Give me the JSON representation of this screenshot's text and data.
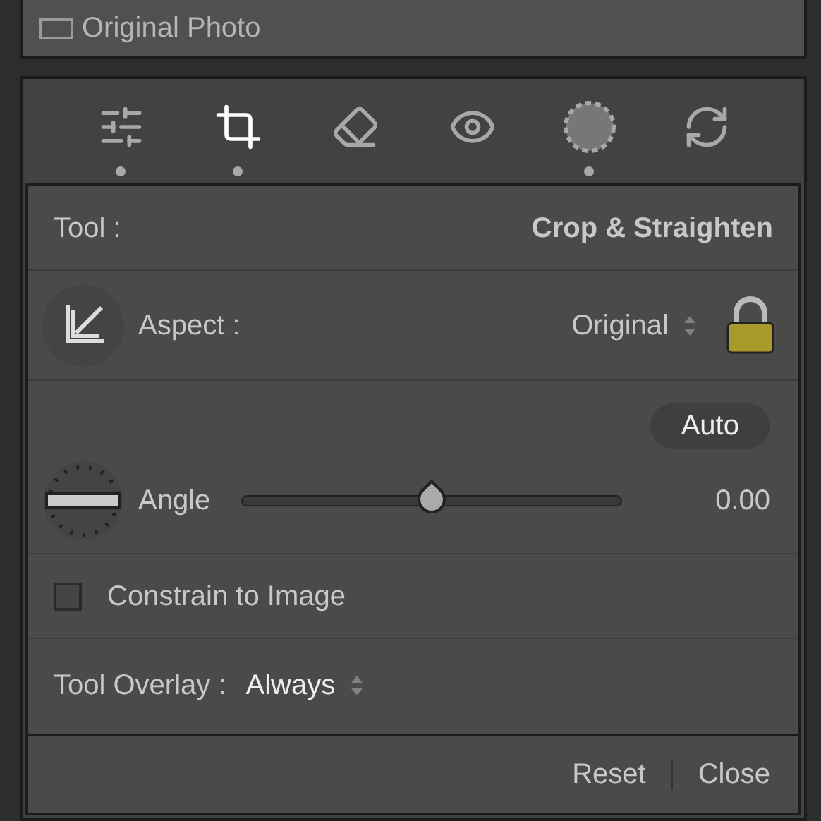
{
  "original_photo": {
    "label": "Original Photo",
    "checked": false
  },
  "tools": [
    {
      "selected": false,
      "edited": true
    },
    {
      "selected": true,
      "edited": true
    },
    {
      "selected": false,
      "edited": false
    },
    {
      "selected": false,
      "edited": false
    },
    {
      "selected": false,
      "edited": true
    },
    {
      "selected": false,
      "edited": false
    }
  ],
  "tool_row": {
    "label": "Tool :",
    "value": "Crop & Straighten"
  },
  "aspect": {
    "label": "Aspect :",
    "value": "Original",
    "locked": true
  },
  "auto_button": "Auto",
  "angle": {
    "label": "Angle",
    "level": 0.5,
    "reading": "0.00"
  },
  "constrain": {
    "label": "Constrain to Image",
    "checked": false
  },
  "tool_overlay": {
    "label": "Tool Overlay :",
    "value": "Always"
  },
  "footer": {
    "reset": "Reset",
    "close": "Close"
  }
}
